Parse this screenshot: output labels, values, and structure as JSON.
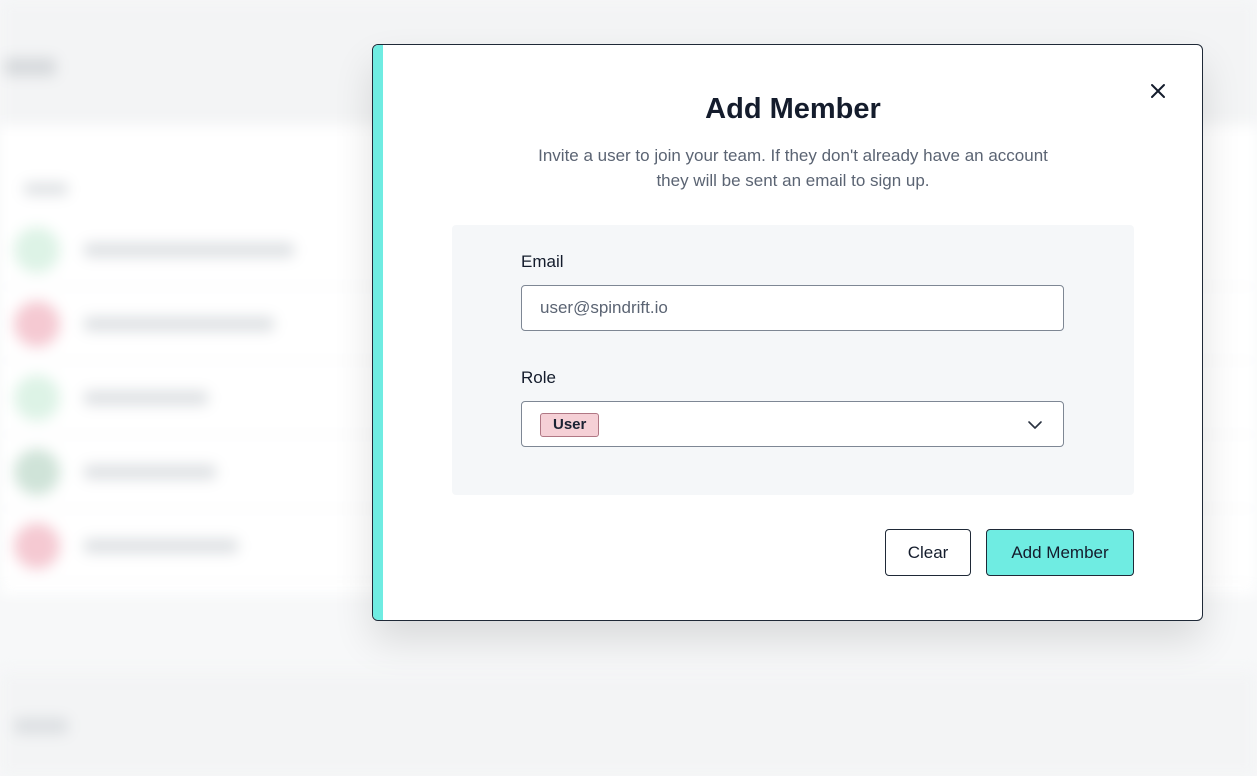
{
  "modal": {
    "title": "Add Member",
    "description": "Invite a user to join your team. If they don't already have an account they will be sent an email to sign up.",
    "accent_color": "#6fece2",
    "close_icon": "close-icon"
  },
  "form": {
    "email": {
      "label": "Email",
      "value": "",
      "placeholder": "user@spindrift.io"
    },
    "role": {
      "label": "Role",
      "selected": "User",
      "icon": "chevron-down-icon"
    }
  },
  "actions": {
    "clear_label": "Clear",
    "add_label": "Add Member"
  }
}
